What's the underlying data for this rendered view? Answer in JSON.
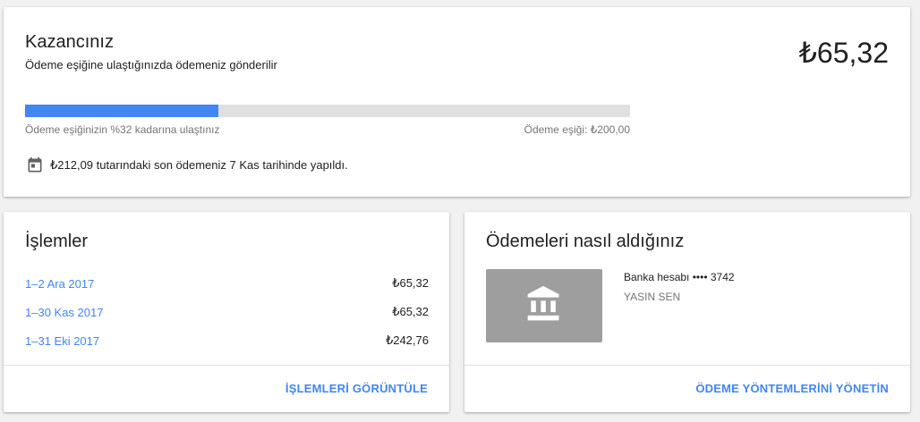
{
  "earnings": {
    "title": "Kazancınız",
    "subtitle": "Ödeme eşiğine ulaştığınızda ödemeniz gönderilir",
    "amount": "₺65,32",
    "progress_fraction": 0.32,
    "progress_text": "Ödeme eşiğinizin %32 kadarına ulaştınız",
    "threshold_text": "Ödeme eşiği: ₺200,00",
    "last_payment_icon": "calendar-icon",
    "last_payment_text": "₺212,09 tutarındaki son ödemeniz 7 Kas tarihinde yapıldı."
  },
  "transactions": {
    "title": "İşlemler",
    "rows": [
      {
        "period": "1–2 Ara 2017",
        "amount": "₺65,32"
      },
      {
        "period": "1–30 Kas 2017",
        "amount": "₺65,32"
      },
      {
        "period": "1–31 Eki 2017",
        "amount": "₺242,76"
      }
    ],
    "action_label": "İŞLEMLERİ GÖRÜNTÜLE"
  },
  "payment_method": {
    "title": "Ödemeleri nasıl aldığınız",
    "icon": "bank-icon",
    "bank_label": "Banka hesabı •••• 3742",
    "account_holder": "YASIN SEN",
    "action_label": "ÖDEME YÖNTEMLERİNİ YÖNETİN"
  },
  "colors": {
    "accent": "#4285f4",
    "progress_track": "#e0e0e0",
    "bank_tile": "#9e9e9e"
  }
}
